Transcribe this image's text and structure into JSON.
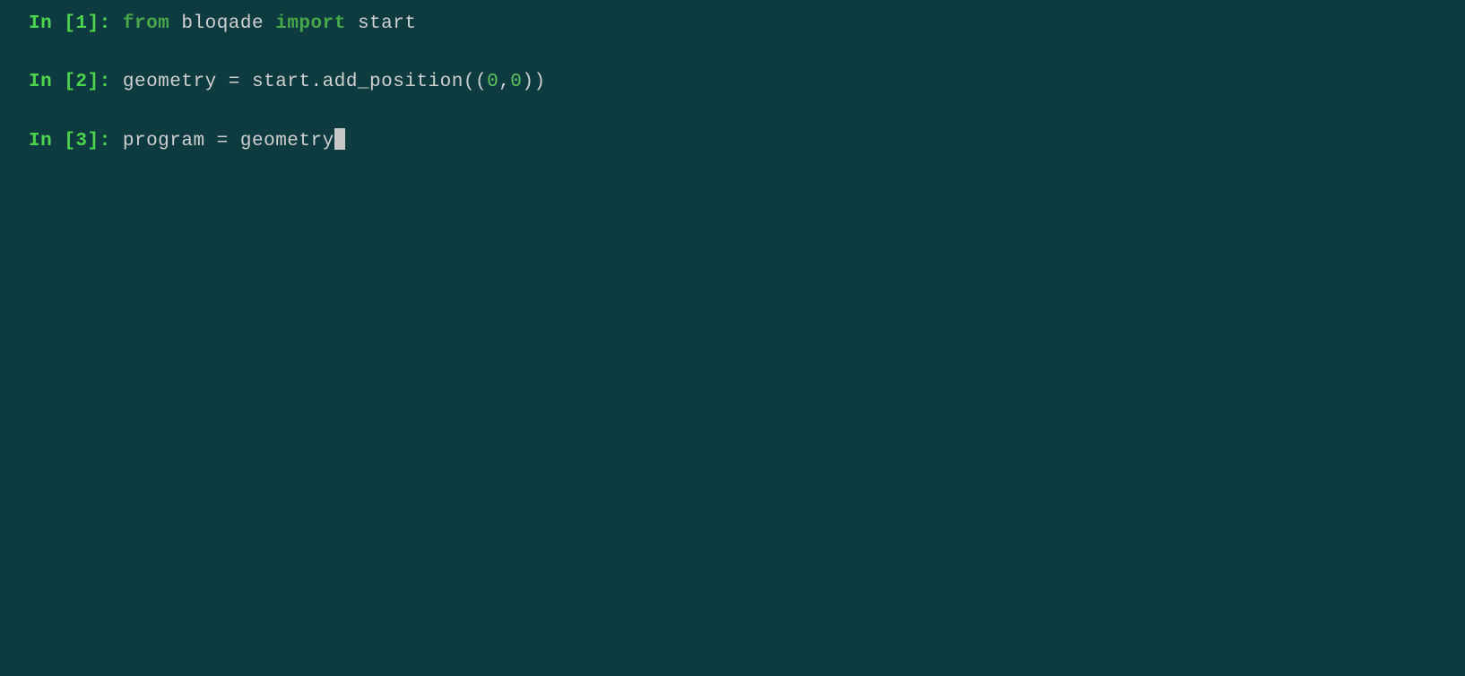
{
  "lines": [
    {
      "prompt_in": "In ",
      "prompt_open": "[",
      "prompt_num": "1",
      "prompt_close": "]",
      "prompt_colon": ": ",
      "tokens": [
        {
          "cls": "keyword",
          "text": "from"
        },
        {
          "cls": "identifier",
          "text": " "
        },
        {
          "cls": "module",
          "text": "bloqade"
        },
        {
          "cls": "identifier",
          "text": " "
        },
        {
          "cls": "keyword",
          "text": "import"
        },
        {
          "cls": "identifier",
          "text": " "
        },
        {
          "cls": "identifier",
          "text": "start"
        }
      ],
      "has_cursor": false
    },
    {
      "prompt_in": "In ",
      "prompt_open": "[",
      "prompt_num": "2",
      "prompt_close": "]",
      "prompt_colon": ": ",
      "tokens": [
        {
          "cls": "identifier",
          "text": "geometry"
        },
        {
          "cls": "operator",
          "text": " = "
        },
        {
          "cls": "identifier",
          "text": "start"
        },
        {
          "cls": "punct",
          "text": "."
        },
        {
          "cls": "identifier",
          "text": "add_position"
        },
        {
          "cls": "punct",
          "text": "(("
        },
        {
          "cls": "number",
          "text": "0"
        },
        {
          "cls": "punct",
          "text": ","
        },
        {
          "cls": "number",
          "text": "0"
        },
        {
          "cls": "punct",
          "text": "))"
        }
      ],
      "has_cursor": false
    },
    {
      "prompt_in": "In ",
      "prompt_open": "[",
      "prompt_num": "3",
      "prompt_close": "]",
      "prompt_colon": ": ",
      "tokens": [
        {
          "cls": "identifier",
          "text": "program"
        },
        {
          "cls": "operator",
          "text": " = "
        },
        {
          "cls": "identifier",
          "text": "geometry"
        }
      ],
      "has_cursor": true
    }
  ]
}
